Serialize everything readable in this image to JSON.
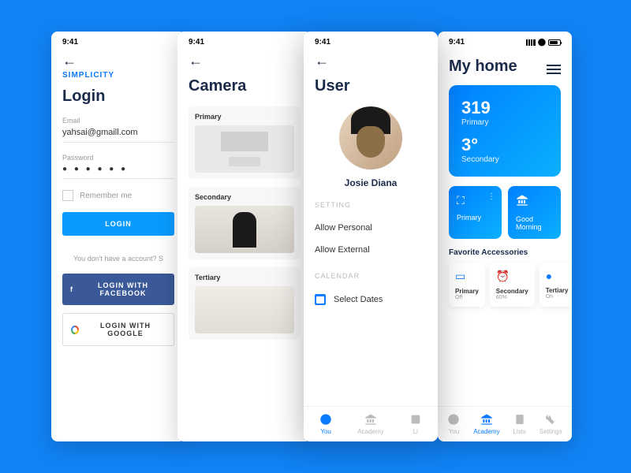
{
  "status_time": "9:41",
  "screen1": {
    "brand": "SIMPLICITY",
    "title": "Login",
    "email_label": "Email",
    "email_value": "yahsai@gmaill.com",
    "password_label": "Password",
    "password_value": "● ● ● ● ● ●",
    "remember_label": "Remember me",
    "login_btn": "LOGIN",
    "no_account": "You don't have a account? S",
    "fb_btn": "LOGIN WITH FACEBOOK",
    "google_btn": "LOGIN WITH GOOGLE"
  },
  "screen2": {
    "title": "Camera",
    "cards": [
      "Primary",
      "Secondary",
      "Tertiary"
    ]
  },
  "screen3": {
    "title": "User",
    "name": "Josie Diana",
    "setting_label": "SETTING",
    "settings": [
      "Allow Personal",
      "Allow External"
    ],
    "calendar_label": "CALENDAR",
    "calendar_item": "Select Dates",
    "nav": [
      "You",
      "Academy",
      "Li"
    ]
  },
  "screen4": {
    "title": "My home",
    "hero_num1": "319",
    "hero_label1": "Primary",
    "hero_num2": "3°",
    "hero_label2": "Secondary",
    "tile1": "Primary",
    "tile2": "Good Morning",
    "fav_label": "Favorite Accessories",
    "favs": [
      {
        "title": "Primary",
        "sub": "Off"
      },
      {
        "title": "Secondary",
        "sub": "60%"
      },
      {
        "title": "Tertiary",
        "sub": "On"
      }
    ],
    "nav": [
      "You",
      "Academy",
      "Lists",
      "Settings"
    ]
  }
}
